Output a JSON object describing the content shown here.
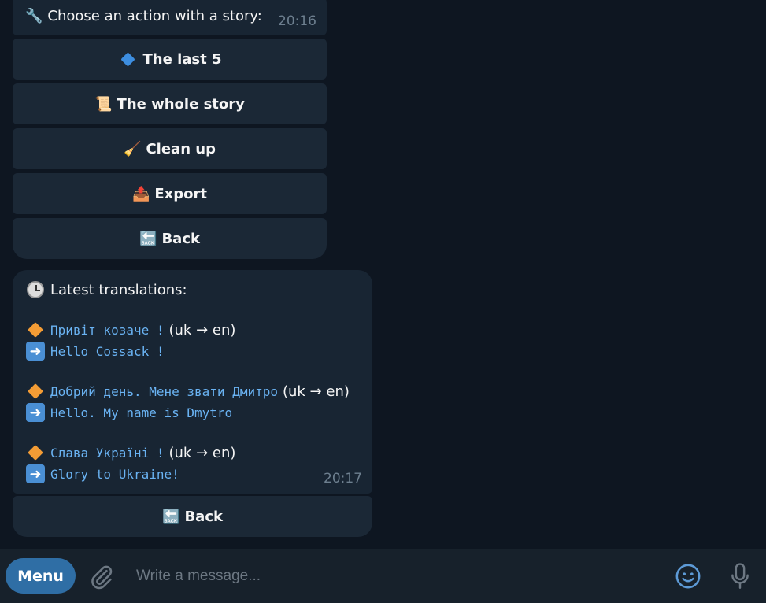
{
  "message1": {
    "text": "Choose an action with a story:",
    "icon": "wrench-icon",
    "time": "20:16",
    "buttons": [
      {
        "label": "The last 5",
        "icon": "blue-diamond-icon"
      },
      {
        "label": "The whole story",
        "icon": "scroll-icon"
      },
      {
        "label": "Clean up",
        "icon": "broom-icon"
      },
      {
        "label": "Export",
        "icon": "outbox-icon"
      },
      {
        "label": "Back",
        "icon": "back-arrow-icon"
      }
    ]
  },
  "message2": {
    "title": "Latest translations:",
    "icon": "clock-icon",
    "time": "20:17",
    "entries": [
      {
        "source": "Привіт козаче !",
        "lang": "(uk → en)",
        "target": "Hello Cossack !"
      },
      {
        "source": "Добрий день. Мене звати Дмитро",
        "lang": "(uk → en)",
        "target": "Hello. My name is Dmytro"
      },
      {
        "source": "Слава Україні !",
        "lang": "(uk → en)",
        "target": "Glory to Ukraine!"
      }
    ],
    "button": {
      "label": "Back",
      "icon": "back-arrow-icon"
    }
  },
  "bottom_bar": {
    "menu_label": "Menu",
    "input_placeholder": "Write a message...",
    "icons": [
      "paperclip-icon",
      "smile-icon",
      "microphone-icon"
    ]
  },
  "colors": {
    "background": "#0e1621",
    "bubble": "#182533",
    "accent": "#2f6ea5",
    "mono_text": "#6ab3f3"
  }
}
